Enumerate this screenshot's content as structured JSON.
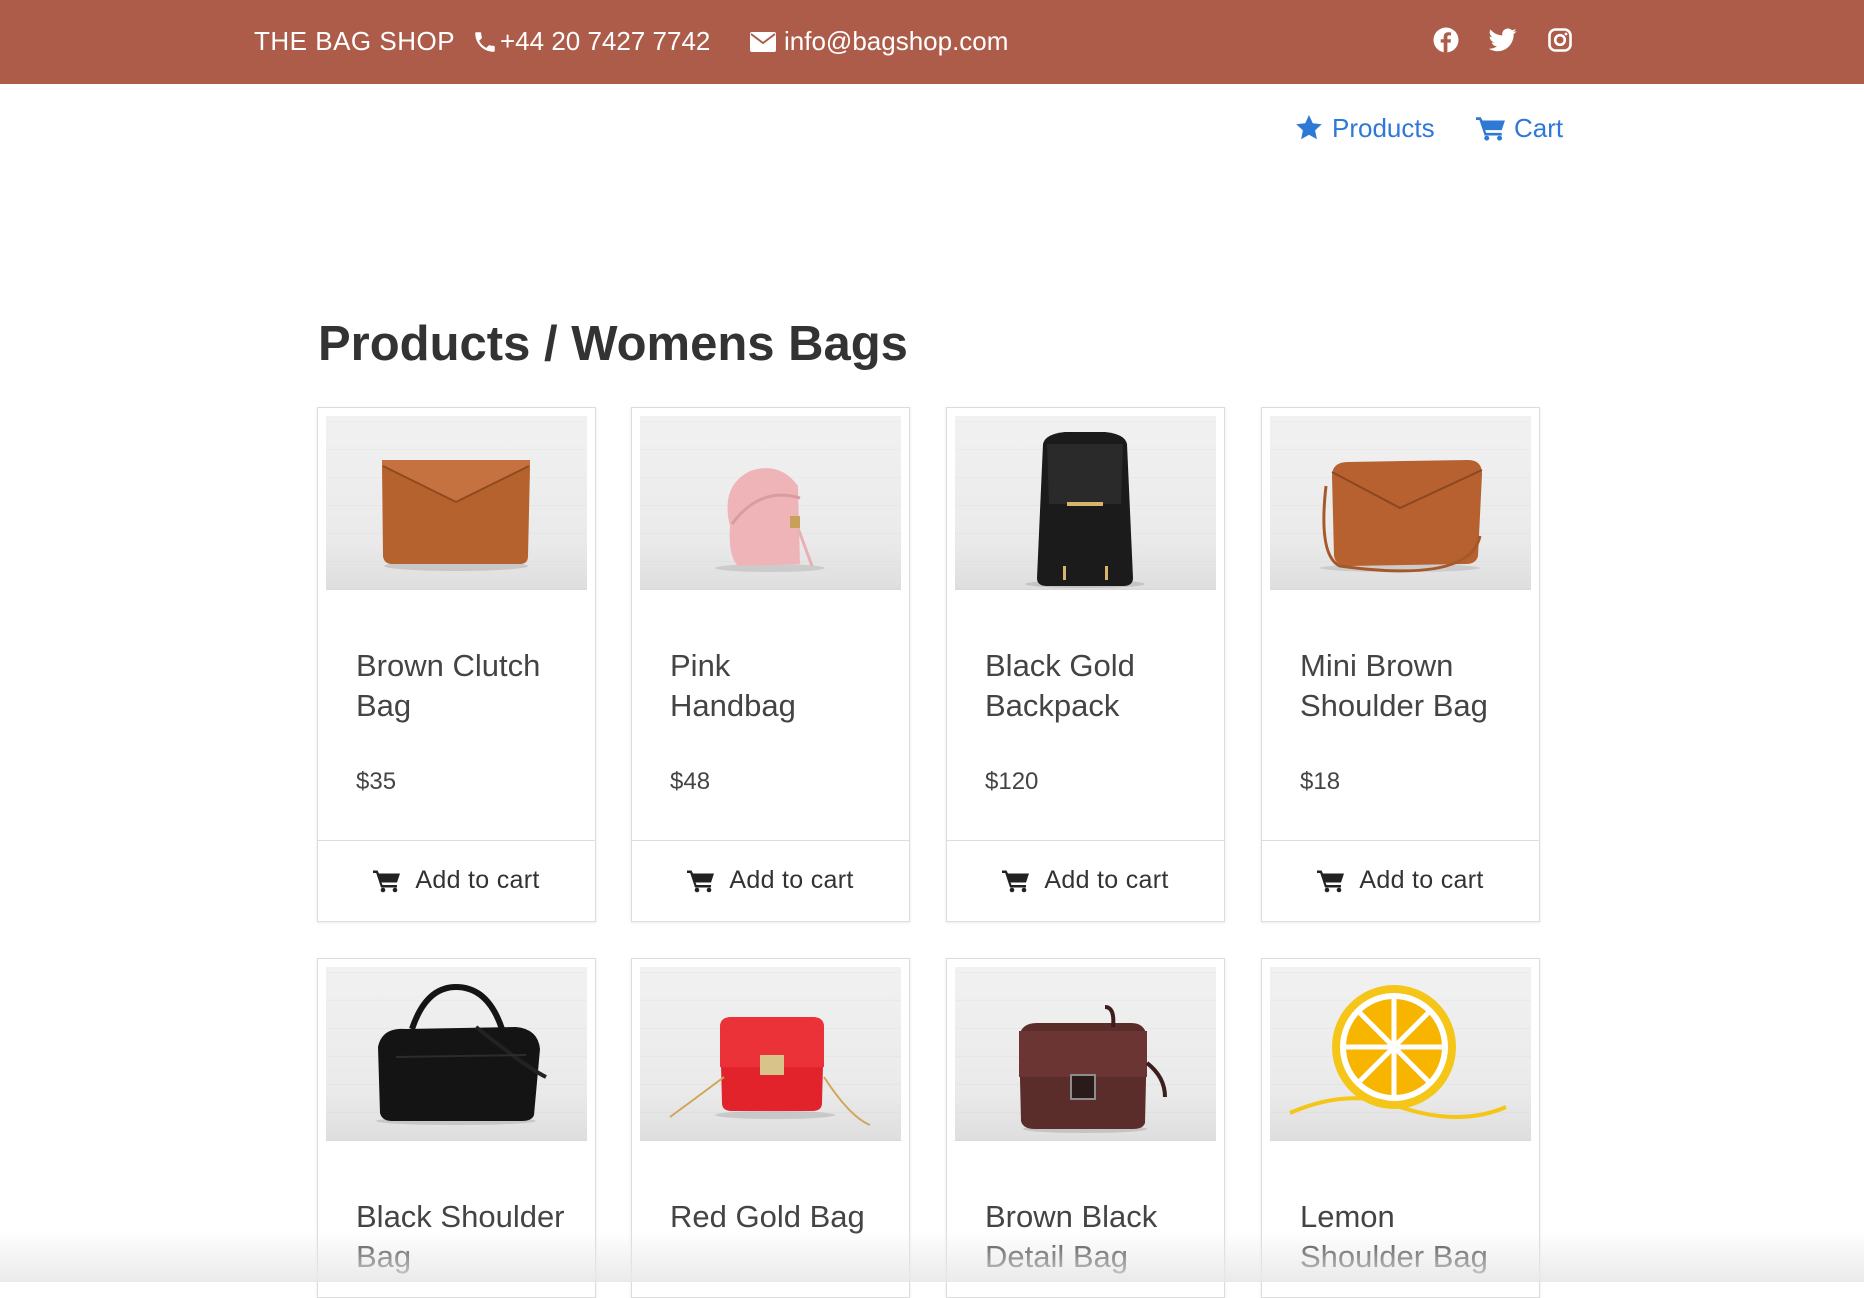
{
  "topbar": {
    "brand": "THE BAG SHOP",
    "phone": "+44 20 7427 7742",
    "email": "info@bagshop.com",
    "background_color": "#ad5c4a",
    "social_icons": [
      "facebook-icon",
      "twitter-icon",
      "instagram-icon"
    ]
  },
  "nav": {
    "products_label": "Products",
    "cart_label": "Cart",
    "link_color": "#2e78d6"
  },
  "main": {
    "title": "Products / Womens Bags",
    "products": [
      {
        "name": "Brown Clutch Bag",
        "price": "$35",
        "button": "Add to cart"
      },
      {
        "name": "Pink Handbag",
        "price": "$48",
        "button": "Add to cart"
      },
      {
        "name": "Black Gold Backpack",
        "price": "$120",
        "button": "Add to cart"
      },
      {
        "name": "Mini Brown Shoulder Bag",
        "price": "$18",
        "button": "Add to cart"
      },
      {
        "name": "Black Shoulder Bag",
        "price": "",
        "button": ""
      },
      {
        "name": "Red Gold Bag",
        "price": "",
        "button": ""
      },
      {
        "name": "Brown Black Detail Bag",
        "price": "",
        "button": ""
      },
      {
        "name": "Lemon Shoulder Bag",
        "price": "",
        "button": ""
      }
    ]
  }
}
